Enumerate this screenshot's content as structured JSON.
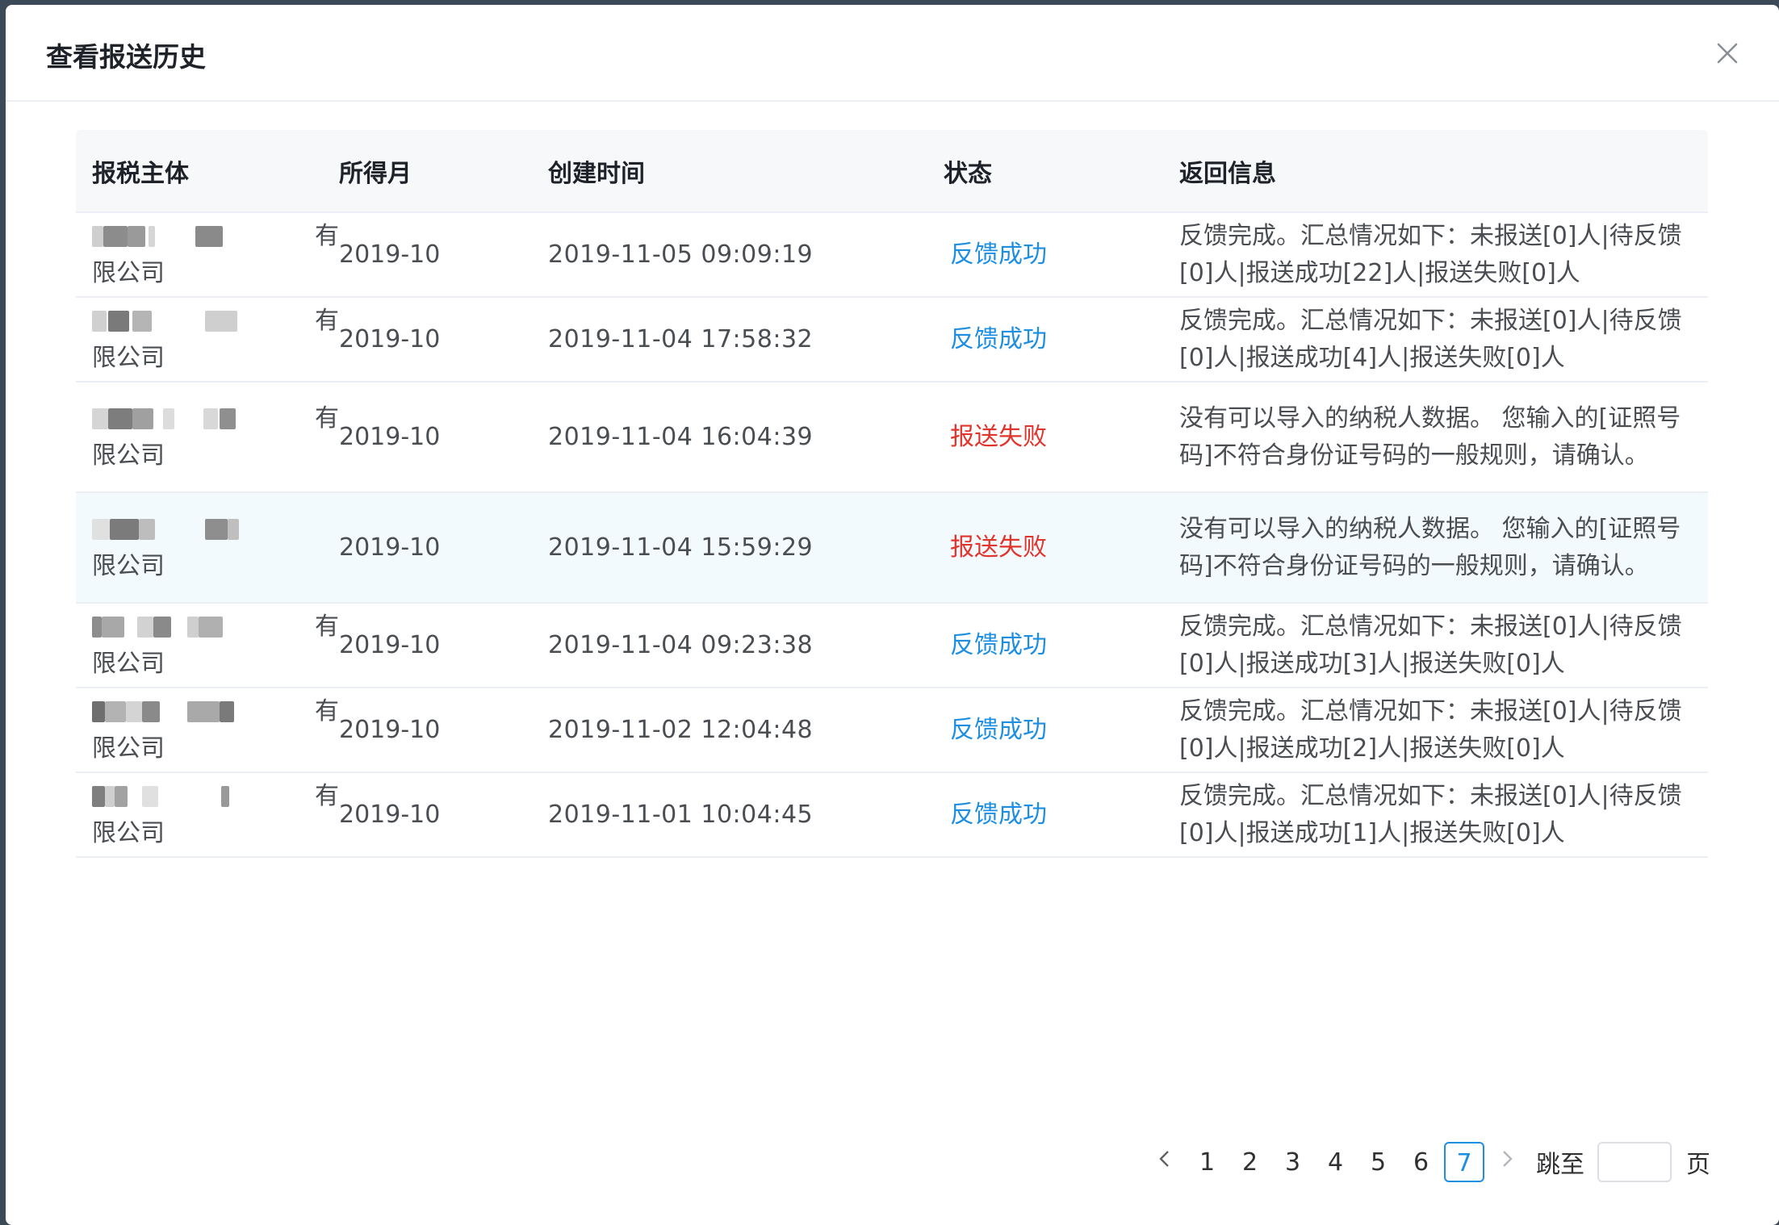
{
  "dialog": {
    "title": "查看报送历史",
    "close_icon": "close-icon"
  },
  "table": {
    "headers": [
      "报税主体",
      "所得月",
      "创建时间",
      "状态",
      "返回信息"
    ],
    "rows": [
      {
        "entity_end": "有",
        "entity_line2": "限公司",
        "month": "2019-10",
        "created": "2019-11-05 09:09:19",
        "status": "反馈成功",
        "status_type": "success",
        "info": "反馈完成。汇总情况如下：未报送[0]人|待反馈[0]人|报送成功[22]人|报送失败[0]人"
      },
      {
        "entity_end": "有",
        "entity_line2": "限公司",
        "month": "2019-10",
        "created": "2019-11-04 17:58:32",
        "status": "反馈成功",
        "status_type": "success",
        "info": "反馈完成。汇总情况如下：未报送[0]人|待反馈[0]人|报送成功[4]人|报送失败[0]人"
      },
      {
        "entity_end": "有",
        "entity_line2": "限公司",
        "month": "2019-10",
        "created": "2019-11-04 16:04:39",
        "status": "报送失败",
        "status_type": "fail",
        "info": "没有可以导入的纳税人数据。 您输入的[证照号码]不符合身份证号码的一般规则，请确认。"
      },
      {
        "entity_end": "",
        "entity_line2": "限公司",
        "month": "2019-10",
        "created": "2019-11-04 15:59:29",
        "status": "报送失败",
        "status_type": "fail",
        "info": "没有可以导入的纳税人数据。 您输入的[证照号码]不符合身份证号码的一般规则，请确认。"
      },
      {
        "entity_end": "有",
        "entity_line2": "限公司",
        "month": "2019-10",
        "created": "2019-11-04 09:23:38",
        "status": "反馈成功",
        "status_type": "success",
        "info": "反馈完成。汇总情况如下：未报送[0]人|待反馈[0]人|报送成功[3]人|报送失败[0]人"
      },
      {
        "entity_end": "有",
        "entity_line2": "限公司",
        "month": "2019-10",
        "created": "2019-11-02 12:04:48",
        "status": "反馈成功",
        "status_type": "success",
        "info": "反馈完成。汇总情况如下：未报送[0]人|待反馈[0]人|报送成功[2]人|报送失败[0]人"
      },
      {
        "entity_end": "有",
        "entity_line2": "限公司",
        "month": "2019-10",
        "created": "2019-11-01 10:04:45",
        "status": "反馈成功",
        "status_type": "success",
        "info": "反馈完成。汇总情况如下：未报送[0]人|待反馈[0]人|报送成功[1]人|报送失败[0]人"
      }
    ]
  },
  "pagination": {
    "prev_icon": "chevron-left-icon",
    "next_icon": "chevron-right-icon",
    "pages": [
      "1",
      "2",
      "3",
      "4",
      "5",
      "6",
      "7"
    ],
    "current_page": "7",
    "jump_label": "跳至",
    "jump_value": "",
    "page_suffix": "页"
  },
  "colors": {
    "success": "#1d8fe3",
    "fail": "#e1342c",
    "hover_row": "#f3fafd",
    "header_bg": "#f7f8fa"
  }
}
